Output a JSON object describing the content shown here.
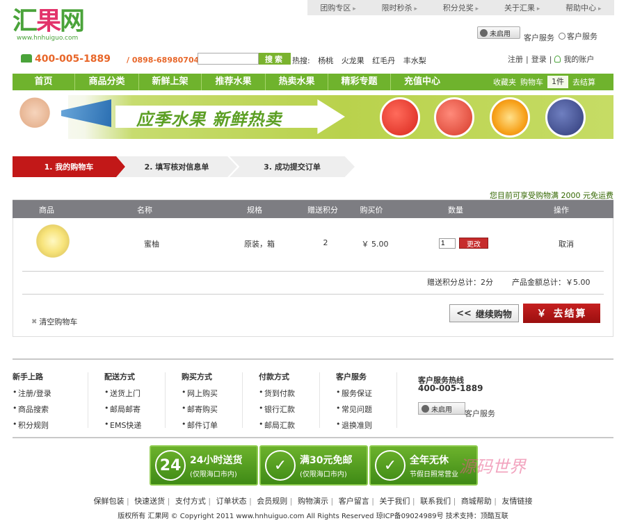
{
  "top_links": [
    "团购专区",
    "限时秒杀",
    "积分兑奖",
    "关于汇果",
    "帮助中心"
  ],
  "logo": {
    "text_a": "汇",
    "text_b": "果",
    "text_c": "网",
    "url": "www.hnhuiguo.com"
  },
  "service": {
    "qq_status": "未启用",
    "label1": "客户服务",
    "label2": "客户服务"
  },
  "contact": {
    "phone": "400-005-1889",
    "phone2": "/ 0898-68980704"
  },
  "search": {
    "button": "搜索",
    "placeholder": ""
  },
  "hot": {
    "label": "热搜:",
    "items": [
      "杨桃",
      "火龙果",
      "红毛丹",
      "丰水梨"
    ]
  },
  "account": {
    "register": "注册",
    "login": "登录",
    "my_account": "我的账户"
  },
  "nav": {
    "items": [
      "首页",
      "商品分类",
      "新鲜上架",
      "推荐水果",
      "热卖水果",
      "精彩专题",
      "充值中心"
    ],
    "favorites": "收藏夹",
    "cart": "购物车",
    "cart_count": "1件",
    "checkout": "去结算"
  },
  "banner": {
    "slogan": "应季水果   新鲜热卖"
  },
  "steps": [
    "1. 我的购物车",
    "2. 填写核对信息单",
    "3. 成功提交订单"
  ],
  "notice": "您目前可享受购物满 2000 元免运费",
  "cart": {
    "headers": [
      "商品",
      "名称",
      "规格",
      "赠送积分",
      "购买价",
      "数量",
      "操作"
    ],
    "rows": [
      {
        "name": "蜜柚",
        "spec": "原装，箱",
        "points": "2",
        "price": "￥ 5.00",
        "qty": "1",
        "change": "更改",
        "cancel": "取消"
      }
    ],
    "points_total": "赠送积分总计：2分",
    "amount_total": "产品金额总计：￥5.00",
    "clear": "清空购物车",
    "continue": "继续购物",
    "continue_icon": "<<",
    "checkout": "去结算",
    "checkout_icon": "￥"
  },
  "footer": {
    "columns": [
      {
        "title": "新手上路",
        "items": [
          "注册/登录",
          "商品搜索",
          "积分规则"
        ]
      },
      {
        "title": "配送方式",
        "items": [
          "送货上门",
          "邮局邮寄",
          "EMS快递"
        ]
      },
      {
        "title": "购买方式",
        "items": [
          "网上购买",
          "邮寄购买",
          "邮件订单"
        ]
      },
      {
        "title": "付款方式",
        "items": [
          "货到付款",
          "银行汇款",
          "邮局汇款"
        ]
      },
      {
        "title": "客户服务",
        "items": [
          "服务保证",
          "常见问题",
          "退换准则"
        ]
      }
    ],
    "hotline_title": "客户服务热线",
    "hotline": "400-005-1889",
    "qq_status": "未启用",
    "service_label": "客户服务",
    "badges": [
      {
        "icon": "24",
        "title": "24小时送货",
        "sub": "(仅限海口市内)"
      },
      {
        "icon": "✓",
        "title": "满30元免邮",
        "sub": "(仅限海口市内)"
      },
      {
        "icon": "✓",
        "title": "全年无休",
        "sub": "节假日照常营业"
      }
    ],
    "watermark": "源码世界",
    "links": [
      "保鲜包装",
      "快速送货",
      "支付方式",
      "订单状态",
      "会员规则",
      "购物演示",
      "客户留言",
      "关于我们",
      "联系我们",
      "商城帮助",
      "友情链接"
    ],
    "copyright": "版权所有 汇果网 © Copyright 2011 www.hnhuiguo.com All Rights Reserved 琼ICP备09024989号 技术支持：顶酷互联"
  }
}
